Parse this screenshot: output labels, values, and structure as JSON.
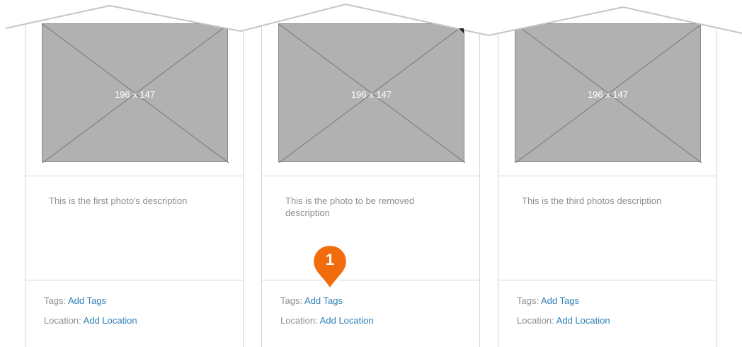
{
  "cards": [
    {
      "thumb_label": "196 x 147",
      "description": "This is the first photo's description",
      "tags_label": "Tags:",
      "tags_link": "Add Tags",
      "location_label": "Location:",
      "location_link": "Add Location"
    },
    {
      "thumb_label": "196 x 147",
      "description": "This is the photo to be removed description",
      "tags_label": "Tags:",
      "tags_link": "Add Tags",
      "location_label": "Location:",
      "location_link": "Add Location"
    },
    {
      "thumb_label": "196 x 147",
      "description": "This is the third photos description",
      "tags_label": "Tags:",
      "tags_link": "Add Tags",
      "location_label": "Location:",
      "location_link": "Add Location"
    }
  ],
  "annotation": {
    "number": "1"
  },
  "colors": {
    "link": "#2d7fb5",
    "marker": "#f26c0d",
    "placeholder": "#b1b1b1",
    "muted_text": "#8e8e8e"
  }
}
